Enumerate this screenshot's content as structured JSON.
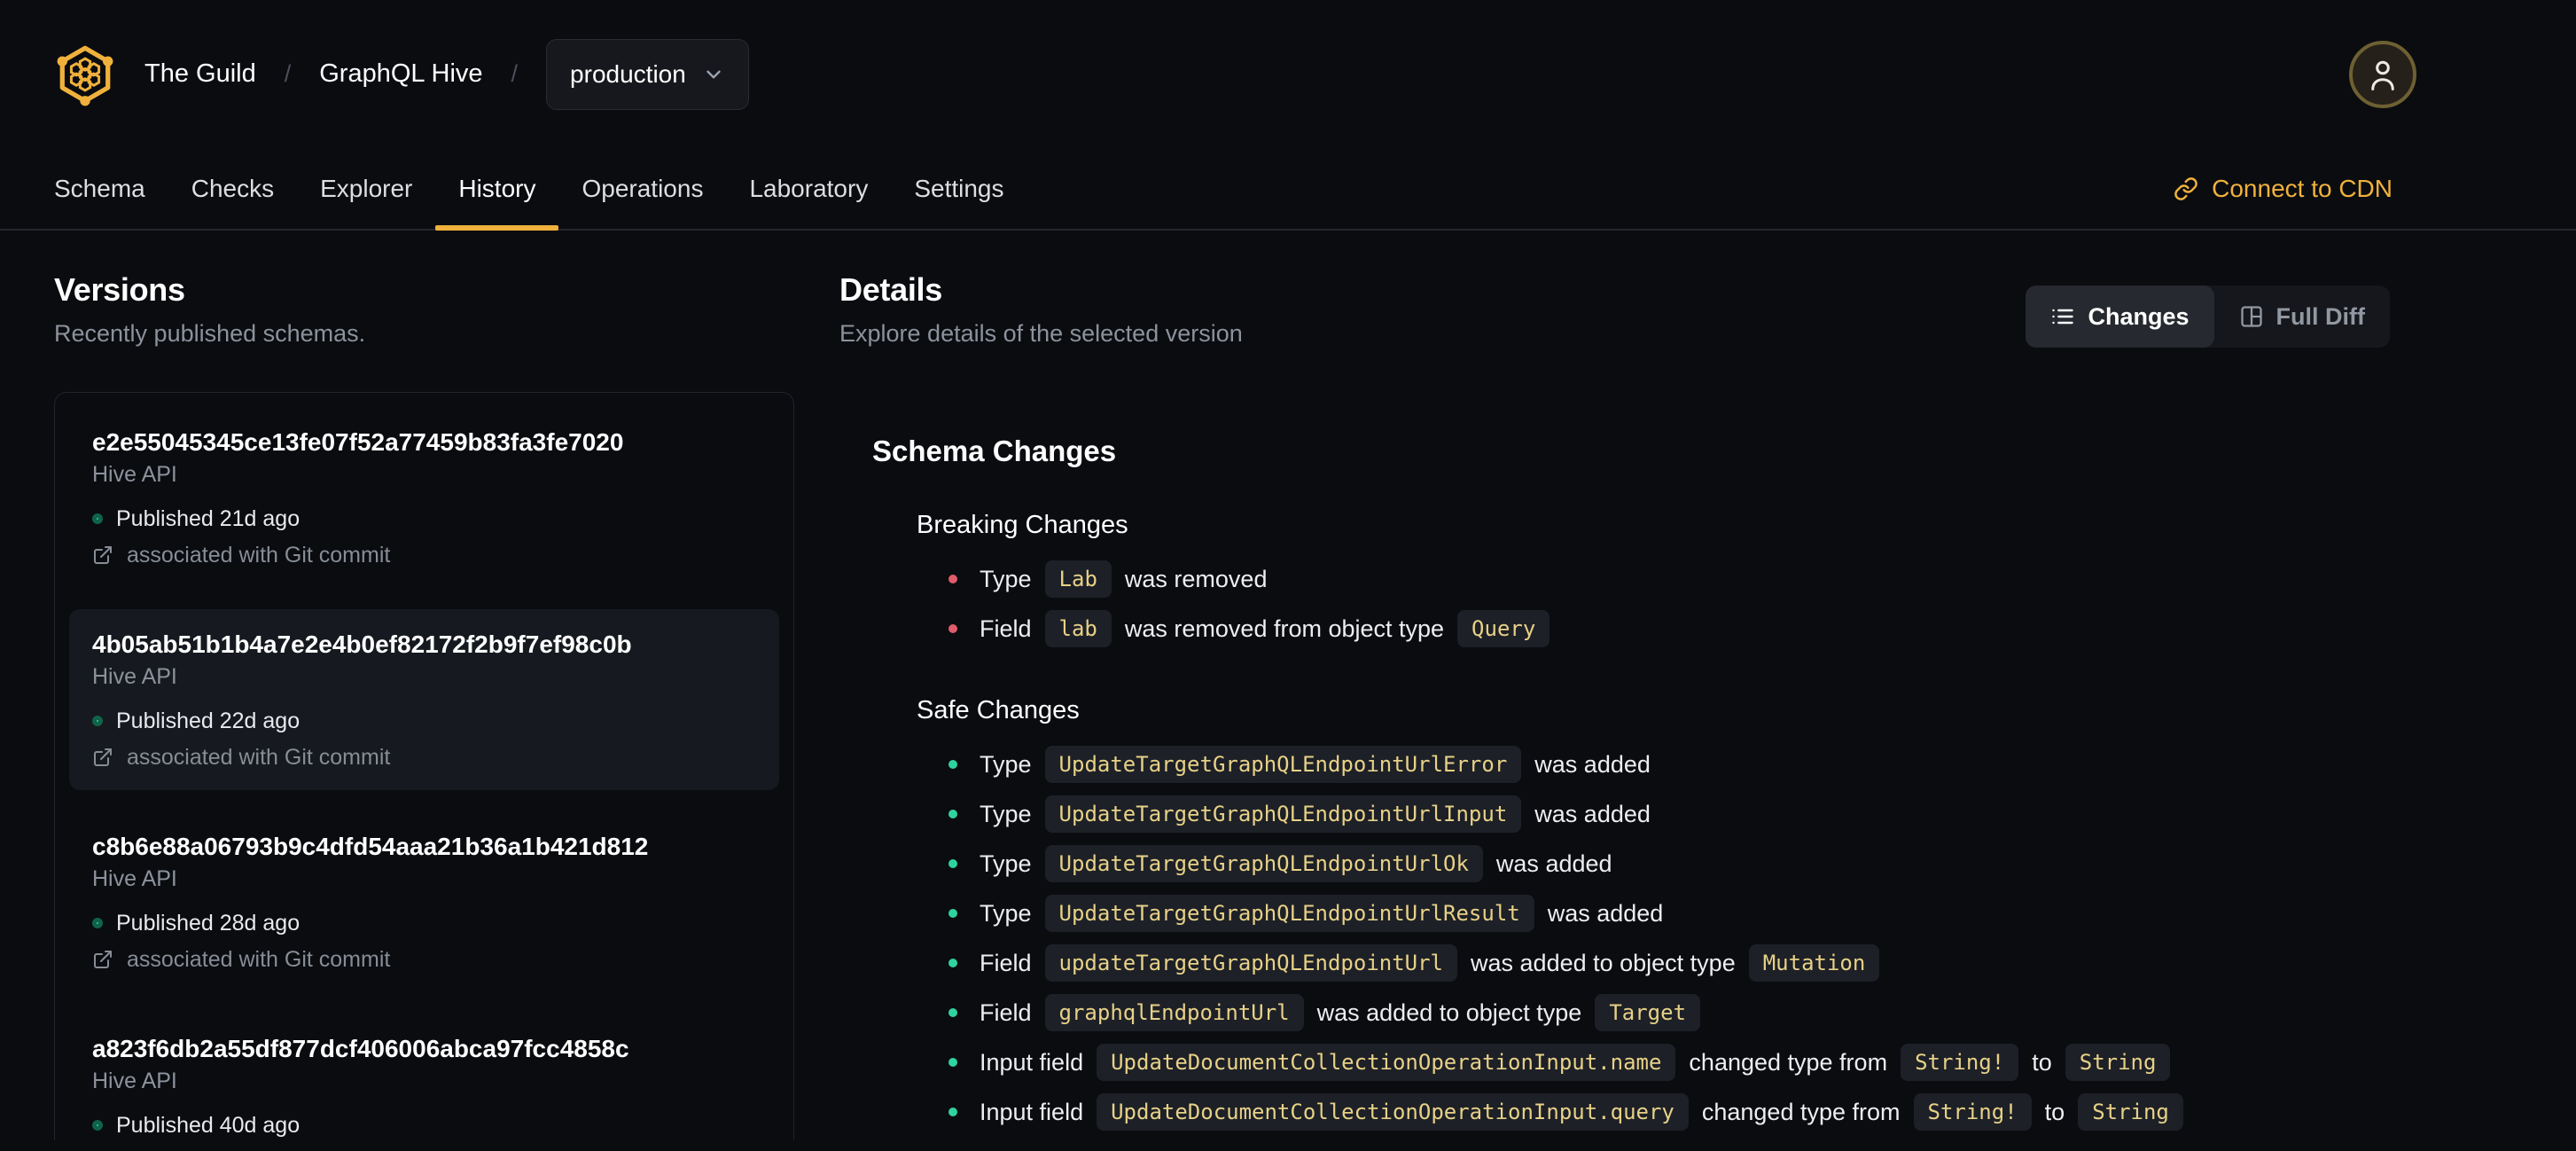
{
  "header": {
    "org": "The Guild",
    "separator": "/",
    "project": "GraphQL Hive",
    "target": "production",
    "tabs": [
      "Schema",
      "Checks",
      "Explorer",
      "History",
      "Operations",
      "Laboratory",
      "Settings"
    ],
    "active_tab": "History",
    "connect_cdn": "Connect to CDN"
  },
  "versions": {
    "title": "Versions",
    "subtitle": "Recently published schemas.",
    "items": [
      {
        "hash": "e2e55045345ce13fe07f52a77459b83fa3fe7020",
        "service": "Hive API",
        "published": "Published 21d ago",
        "git": "associated with Git commit",
        "selected": false
      },
      {
        "hash": "4b05ab51b1b4a7e2e4b0ef82172f2b9f7ef98c0b",
        "service": "Hive API",
        "published": "Published 22d ago",
        "git": "associated with Git commit",
        "selected": true
      },
      {
        "hash": "c8b6e88a06793b9c4dfd54aaa21b36a1b421d812",
        "service": "Hive API",
        "published": "Published 28d ago",
        "git": "associated with Git commit",
        "selected": false
      },
      {
        "hash": "a823f6db2a55df877dcf406006abca97fcc4858c",
        "service": "Hive API",
        "published": "Published 40d ago",
        "git": "",
        "selected": false
      }
    ]
  },
  "details": {
    "title": "Details",
    "subtitle": "Explore details of the selected version",
    "changes_label": "Changes",
    "full_diff_label": "Full Diff",
    "schema_changes_title": "Schema Changes",
    "sections": [
      {
        "title": "Breaking Changes",
        "severity": "breaking",
        "rows": [
          [
            {
              "t": "text",
              "v": "Type"
            },
            {
              "t": "code",
              "v": "Lab"
            },
            {
              "t": "text",
              "v": "was removed"
            }
          ],
          [
            {
              "t": "text",
              "v": "Field"
            },
            {
              "t": "code",
              "v": "lab"
            },
            {
              "t": "text",
              "v": "was removed from object type"
            },
            {
              "t": "code",
              "v": "Query"
            }
          ]
        ]
      },
      {
        "title": "Safe Changes",
        "severity": "safe",
        "rows": [
          [
            {
              "t": "text",
              "v": "Type"
            },
            {
              "t": "code",
              "v": "UpdateTargetGraphQLEndpointUrlError"
            },
            {
              "t": "text",
              "v": "was added"
            }
          ],
          [
            {
              "t": "text",
              "v": "Type"
            },
            {
              "t": "code",
              "v": "UpdateTargetGraphQLEndpointUrlInput"
            },
            {
              "t": "text",
              "v": "was added"
            }
          ],
          [
            {
              "t": "text",
              "v": "Type"
            },
            {
              "t": "code",
              "v": "UpdateTargetGraphQLEndpointUrlOk"
            },
            {
              "t": "text",
              "v": "was added"
            }
          ],
          [
            {
              "t": "text",
              "v": "Type"
            },
            {
              "t": "code",
              "v": "UpdateTargetGraphQLEndpointUrlResult"
            },
            {
              "t": "text",
              "v": "was added"
            }
          ],
          [
            {
              "t": "text",
              "v": "Field"
            },
            {
              "t": "code",
              "v": "updateTargetGraphQLEndpointUrl"
            },
            {
              "t": "text",
              "v": "was added to object type"
            },
            {
              "t": "code",
              "v": "Mutation"
            }
          ],
          [
            {
              "t": "text",
              "v": "Field"
            },
            {
              "t": "code",
              "v": "graphqlEndpointUrl"
            },
            {
              "t": "text",
              "v": "was added to object type"
            },
            {
              "t": "code",
              "v": "Target"
            }
          ],
          [
            {
              "t": "text",
              "v": "Input field"
            },
            {
              "t": "code",
              "v": "UpdateDocumentCollectionOperationInput.name"
            },
            {
              "t": "text",
              "v": "changed type from"
            },
            {
              "t": "code",
              "v": "String!"
            },
            {
              "t": "text",
              "v": "to"
            },
            {
              "t": "code",
              "v": "String"
            }
          ],
          [
            {
              "t": "text",
              "v": "Input field"
            },
            {
              "t": "code",
              "v": "UpdateDocumentCollectionOperationInput.query"
            },
            {
              "t": "text",
              "v": "changed type from"
            },
            {
              "t": "code",
              "v": "String!"
            },
            {
              "t": "text",
              "v": "to"
            },
            {
              "t": "code",
              "v": "String"
            }
          ]
        ]
      }
    ]
  },
  "theme": {
    "background": "#0a0c10",
    "accent_yellow": "#f0b13c",
    "badge_bg": "#1d2027",
    "badge_text": "#e7d187",
    "breaking_red": "#e05c6c",
    "safe_green": "#2fd3a0",
    "published_green": "#2fd6a2",
    "selected_card_bg": "#16191f",
    "muted_gray": "#8c929c",
    "border_gray": "#21252c"
  }
}
